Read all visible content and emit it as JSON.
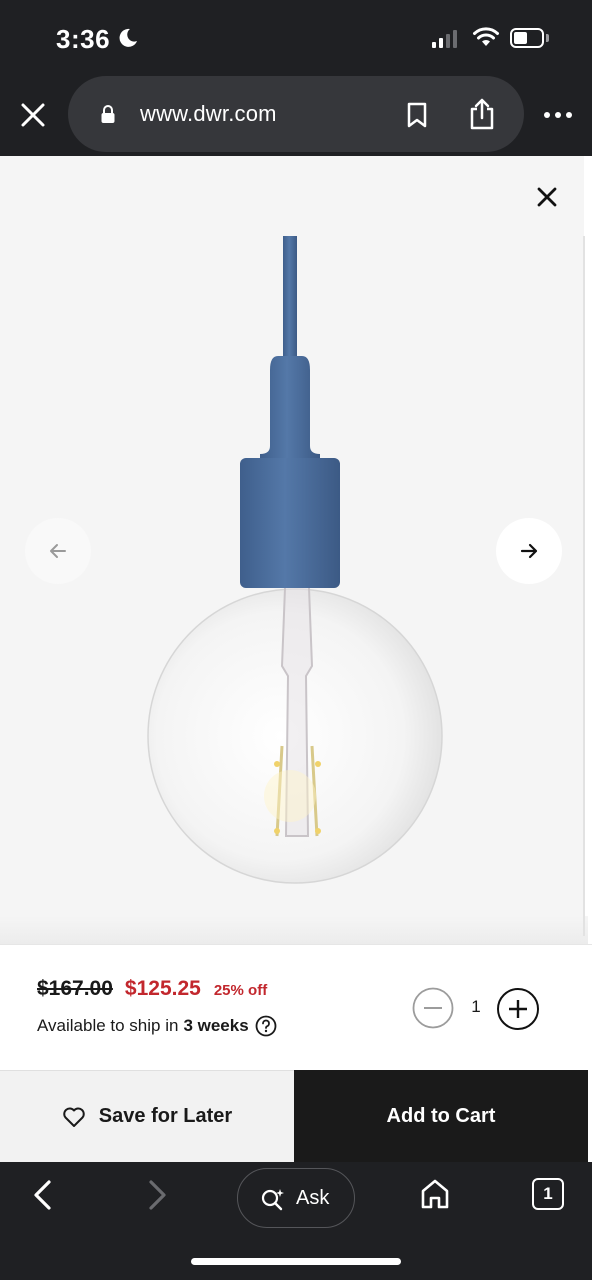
{
  "status_bar": {
    "time": "3:36"
  },
  "browser": {
    "url": "www.dwr.com",
    "toolbar": {
      "ask_label": "Ask",
      "tab_count": "1"
    }
  },
  "product": {
    "original_price": "$167.00",
    "sale_price": "$125.25",
    "discount": "25% off",
    "ship_text": "Available to ship in",
    "ship_time": "3 weeks",
    "quantity": "1"
  },
  "actions": {
    "save_label": "Save for Later",
    "cart_label": "Add to Cart"
  },
  "colors": {
    "sale_red": "#c2272d",
    "lamp_blue": "#4a6b99",
    "chrome_dark": "#1f2023"
  }
}
